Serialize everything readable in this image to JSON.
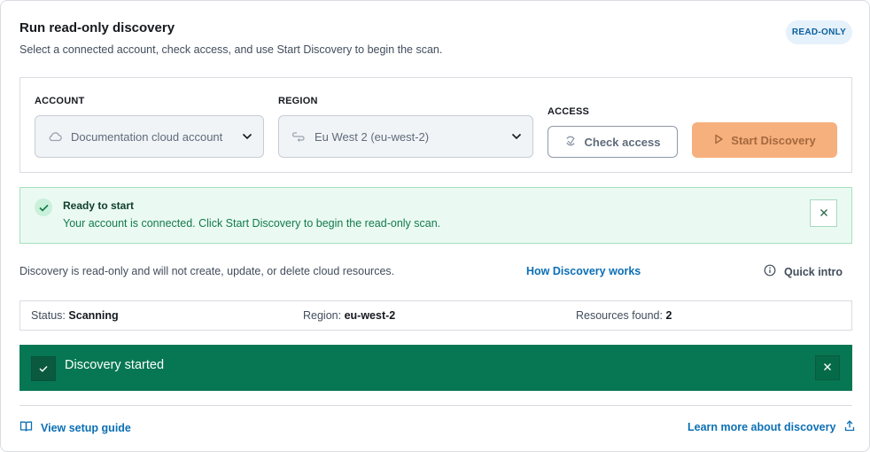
{
  "header": {
    "title": "Run read-only discovery",
    "subtitle": "Select a connected account, check access, and use Start Discovery to begin the scan.",
    "badge": "READ-ONLY"
  },
  "form": {
    "account": {
      "label": "ACCOUNT",
      "value": "Documentation cloud account",
      "icon": "cloud-icon"
    },
    "region": {
      "label": "REGION",
      "value": "Eu West 2 (eu-west-2)",
      "icon": "route-icon"
    },
    "access": {
      "label": "ACCESS"
    },
    "check_access_label": "Check access",
    "start_discovery_label": "Start Discovery"
  },
  "ready_alert": {
    "title": "Ready to start",
    "body": "Your account is connected. Click Start Discovery to begin the read-only scan."
  },
  "info": {
    "text": "Discovery is read-only and will not create, update, or delete cloud resources.",
    "how_link": "How Discovery works",
    "quick_intro": "Quick intro"
  },
  "status": {
    "status_label": "Status:",
    "status_value": "Scanning",
    "region_label": "Region:",
    "region_value": "eu-west-2",
    "resources_label": "Resources found:",
    "resources_value": "2"
  },
  "banner": {
    "text": "Discovery started",
    "color": "#067752"
  },
  "footer": {
    "setup_guide": "View setup guide",
    "learn_more": "Learn more about discovery"
  }
}
